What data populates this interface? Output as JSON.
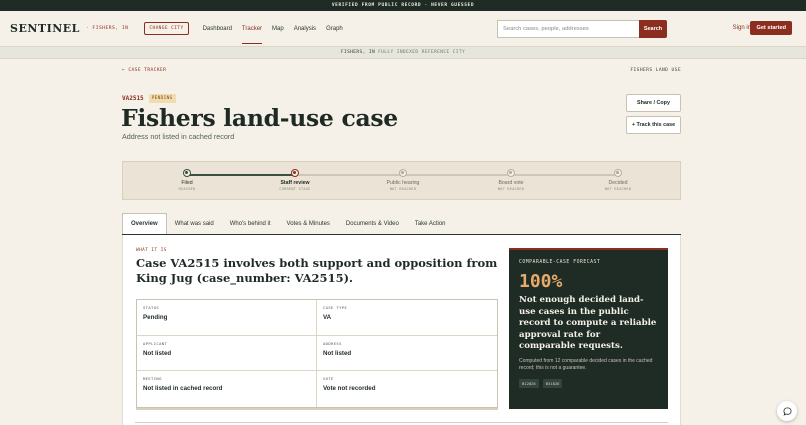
{
  "banner": {
    "text": "VERIFIED FROM PUBLIC RECORD · NEVER GUESSED"
  },
  "nav": {
    "brand": "SENTINEL",
    "brand_city": "· FISHERS, IN",
    "change_city": "CHANGE CITY",
    "links": [
      {
        "label": "Dashboard",
        "active": false
      },
      {
        "label": "Tracker",
        "active": true
      },
      {
        "label": "Map",
        "active": false
      },
      {
        "label": "Analysis",
        "active": false
      },
      {
        "label": "Graph",
        "active": false
      }
    ],
    "search_placeholder": "Search cases, people, addresses",
    "search_button": "Search",
    "sign_in": "Sign in",
    "get_started": "Get started"
  },
  "cityband": {
    "city": "FISHERS, IN",
    "note": "FULLY INDEXED REFERENCE CITY"
  },
  "breadcrumb": {
    "back": "← CASE TRACKER",
    "right": "FISHERS LAND USE"
  },
  "case": {
    "id": "VA2515",
    "status_badge": "PENDING",
    "title": "Fishers land-use case",
    "subtitle": "Address not listed in cached record"
  },
  "actions": {
    "share": "Share / Copy",
    "track": "+ Track this case"
  },
  "stages": [
    {
      "label": "Filed",
      "sub": "REACHED",
      "state": "reached"
    },
    {
      "label": "Staff review",
      "sub": "CURRENT STAGE",
      "state": "current"
    },
    {
      "label": "Public hearing",
      "sub": "NOT REACHED",
      "state": "pending"
    },
    {
      "label": "Board vote",
      "sub": "NOT REACHED",
      "state": "pending"
    },
    {
      "label": "Decided",
      "sub": "NOT REACHED",
      "state": "pending"
    }
  ],
  "tabs": [
    {
      "label": "Overview",
      "active": true
    },
    {
      "label": "What was said",
      "active": false
    },
    {
      "label": "Who's behind it",
      "active": false
    },
    {
      "label": "Votes & Minutes",
      "active": false
    },
    {
      "label": "Documents & Video",
      "active": false
    },
    {
      "label": "Take Action",
      "active": false
    }
  ],
  "overview": {
    "kicker": "WHAT IT IS",
    "summary": "Case VA2515 involves both support and opposition from King Jug (case_number: VA2515).",
    "facts": [
      {
        "key": "STATUS",
        "value": "Pending"
      },
      {
        "key": "CASE TYPE",
        "value": "VA"
      },
      {
        "key": "APPLICANT",
        "value": "Not listed"
      },
      {
        "key": "ADDRESS",
        "value": "Not listed"
      },
      {
        "key": "MEETING",
        "value": "Not listed in cached record"
      },
      {
        "key": "VOTE",
        "value": "Vote not recorded"
      }
    ]
  },
  "forecast": {
    "kicker": "COMPARABLE-CASE FORECAST",
    "big": "100%",
    "headline": "Not enough decided land-use cases in the public record to compute a reliable approval rate for comparable requests.",
    "note": "Computed from 12 comparable decided cases in the cached record; this is not a guarantee.",
    "tags": [
      "B12826",
      "B31826"
    ]
  }
}
